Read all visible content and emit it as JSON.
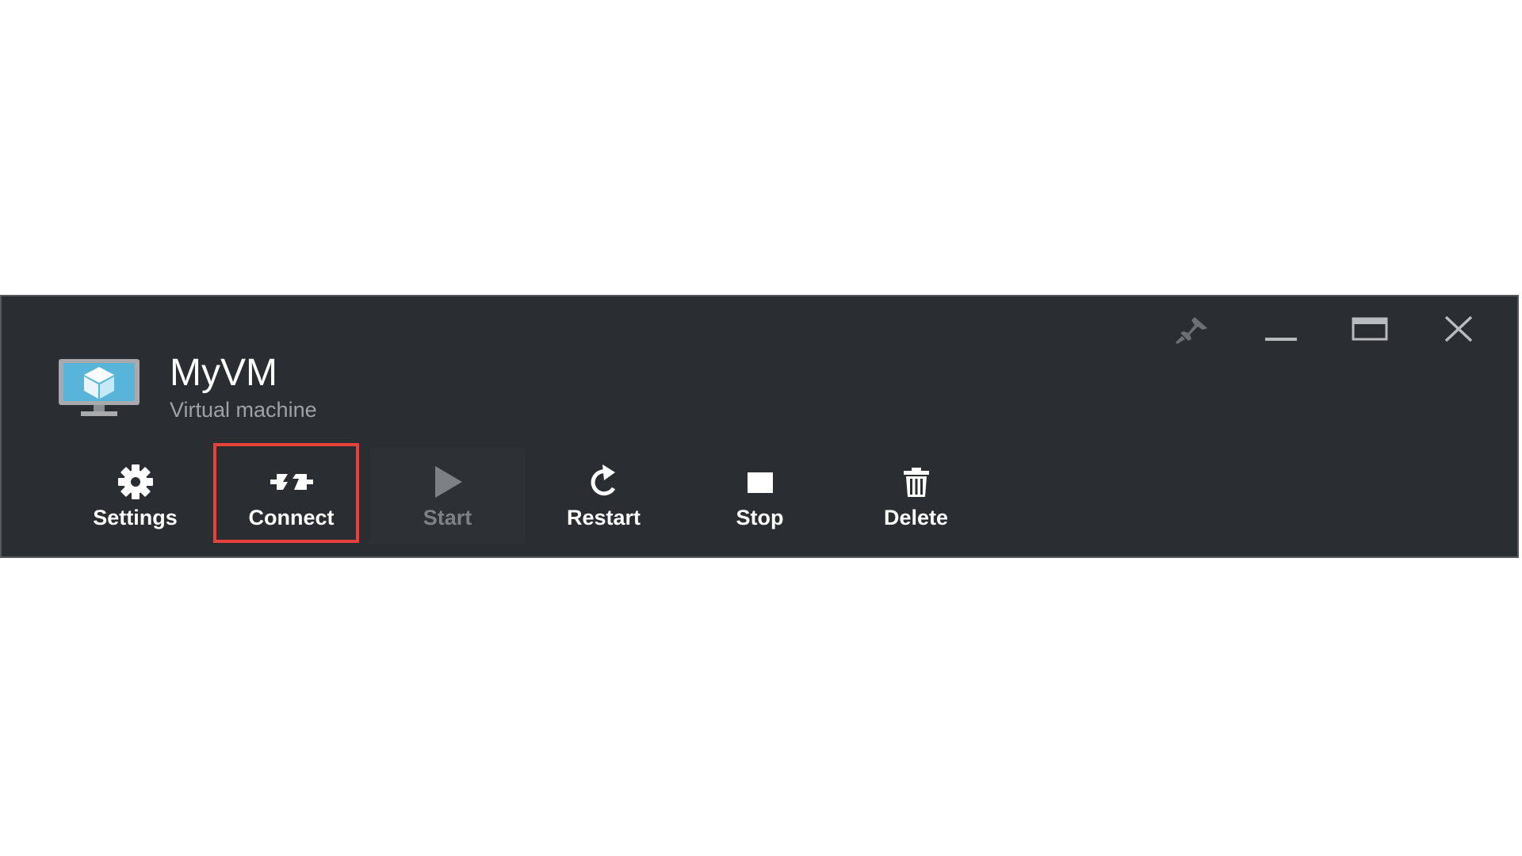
{
  "window": {
    "title": "MyVM",
    "subtitle": "Virtual machine",
    "controls": [
      {
        "name": "pin-icon"
      },
      {
        "name": "minimize-icon"
      },
      {
        "name": "maximize-icon"
      },
      {
        "name": "close-icon"
      }
    ]
  },
  "toolbar": {
    "settings_label": "Settings",
    "connect_label": "Connect",
    "start_label": "Start",
    "restart_label": "Restart",
    "stop_label": "Stop",
    "delete_label": "Delete"
  },
  "colors": {
    "blade_background": "#2a2d31",
    "highlight_border": "#e8413a",
    "vm_icon_blue": "#59b4d9",
    "disabled_text": "#7d8185"
  }
}
